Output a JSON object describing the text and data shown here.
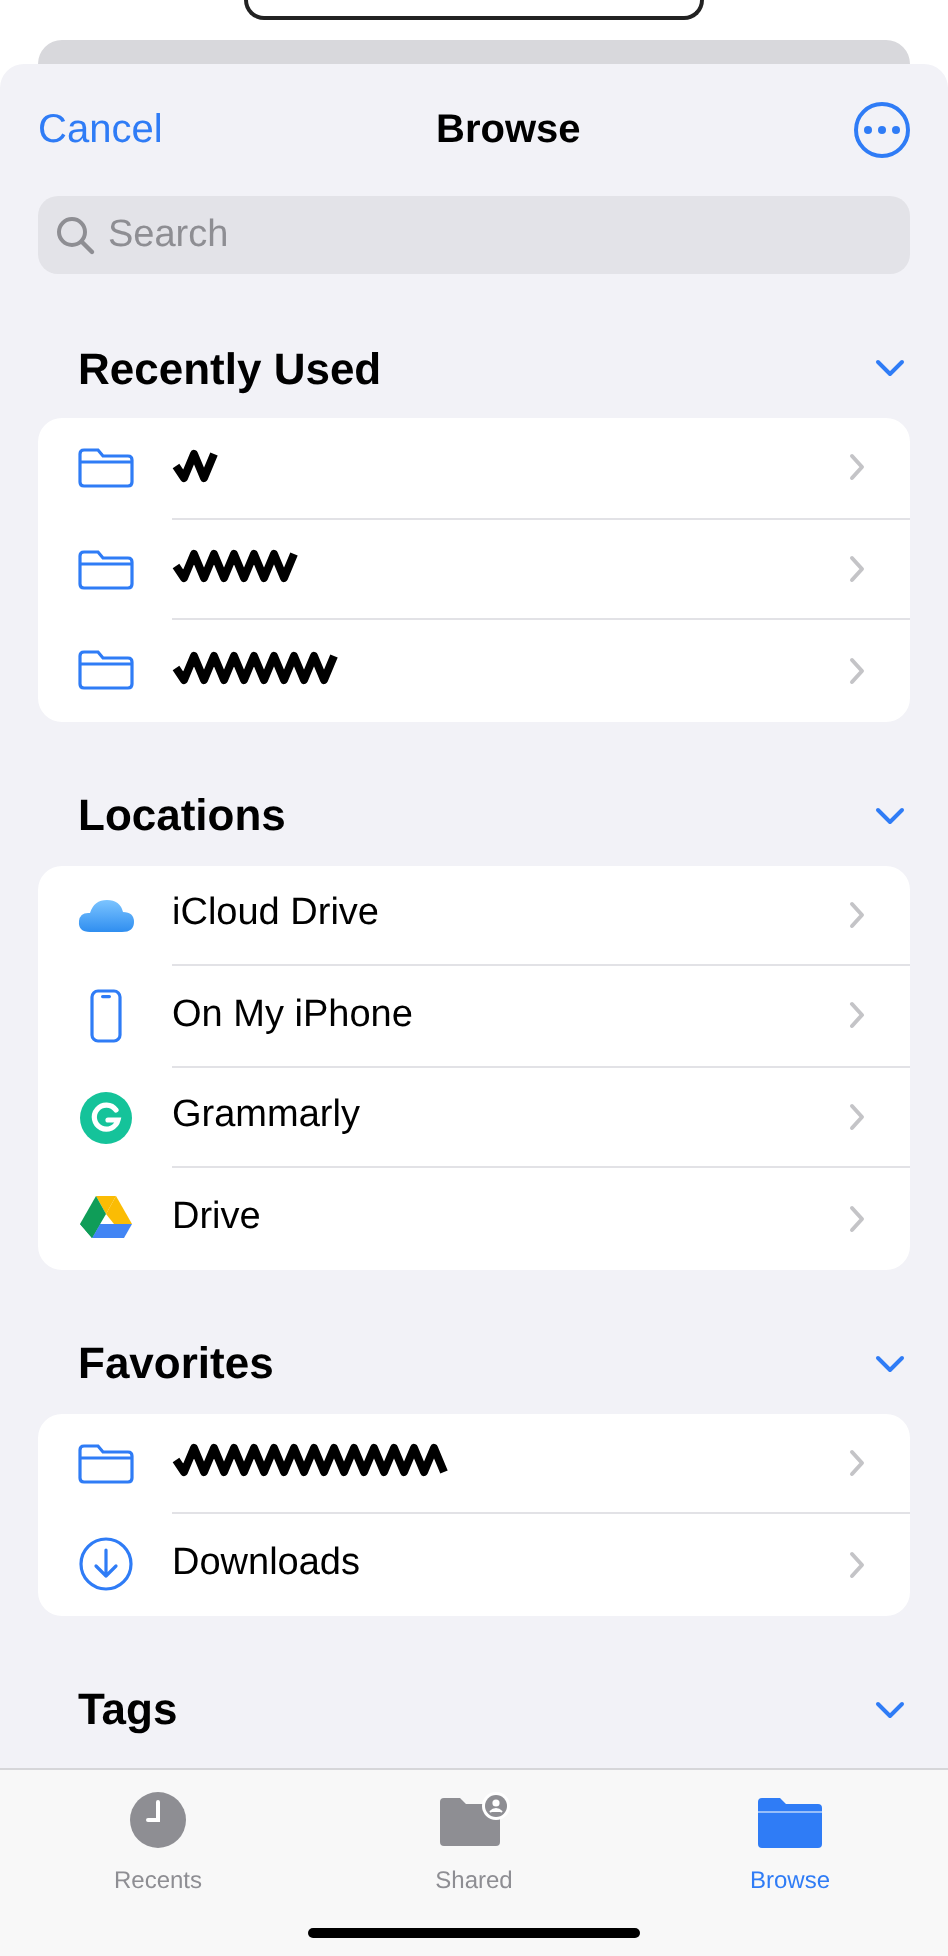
{
  "header": {
    "cancel": "Cancel",
    "title": "Browse"
  },
  "search": {
    "placeholder": "Search"
  },
  "sections": [
    {
      "title": "Recently Used",
      "expanded": true,
      "items": [
        {
          "kind": "redacted-folder"
        },
        {
          "kind": "redacted-folder"
        },
        {
          "kind": "redacted-folder"
        }
      ]
    },
    {
      "title": "Locations",
      "expanded": true,
      "items": [
        {
          "kind": "cloud",
          "label": "iCloud Drive"
        },
        {
          "kind": "phone",
          "label": "On My iPhone"
        },
        {
          "kind": "grammarly",
          "label": "Grammarly"
        },
        {
          "kind": "drive",
          "label": "Drive"
        }
      ]
    },
    {
      "title": "Favorites",
      "expanded": true,
      "items": [
        {
          "kind": "redacted-folder"
        },
        {
          "kind": "download",
          "label": "Downloads"
        }
      ]
    },
    {
      "title": "Tags",
      "expanded": true
    }
  ],
  "tabs": [
    {
      "kind": "clock",
      "label": "Recents",
      "selected": false
    },
    {
      "kind": "shared",
      "label": "Shared",
      "selected": false
    },
    {
      "kind": "folder",
      "label": "Browse",
      "selected": true
    }
  ]
}
